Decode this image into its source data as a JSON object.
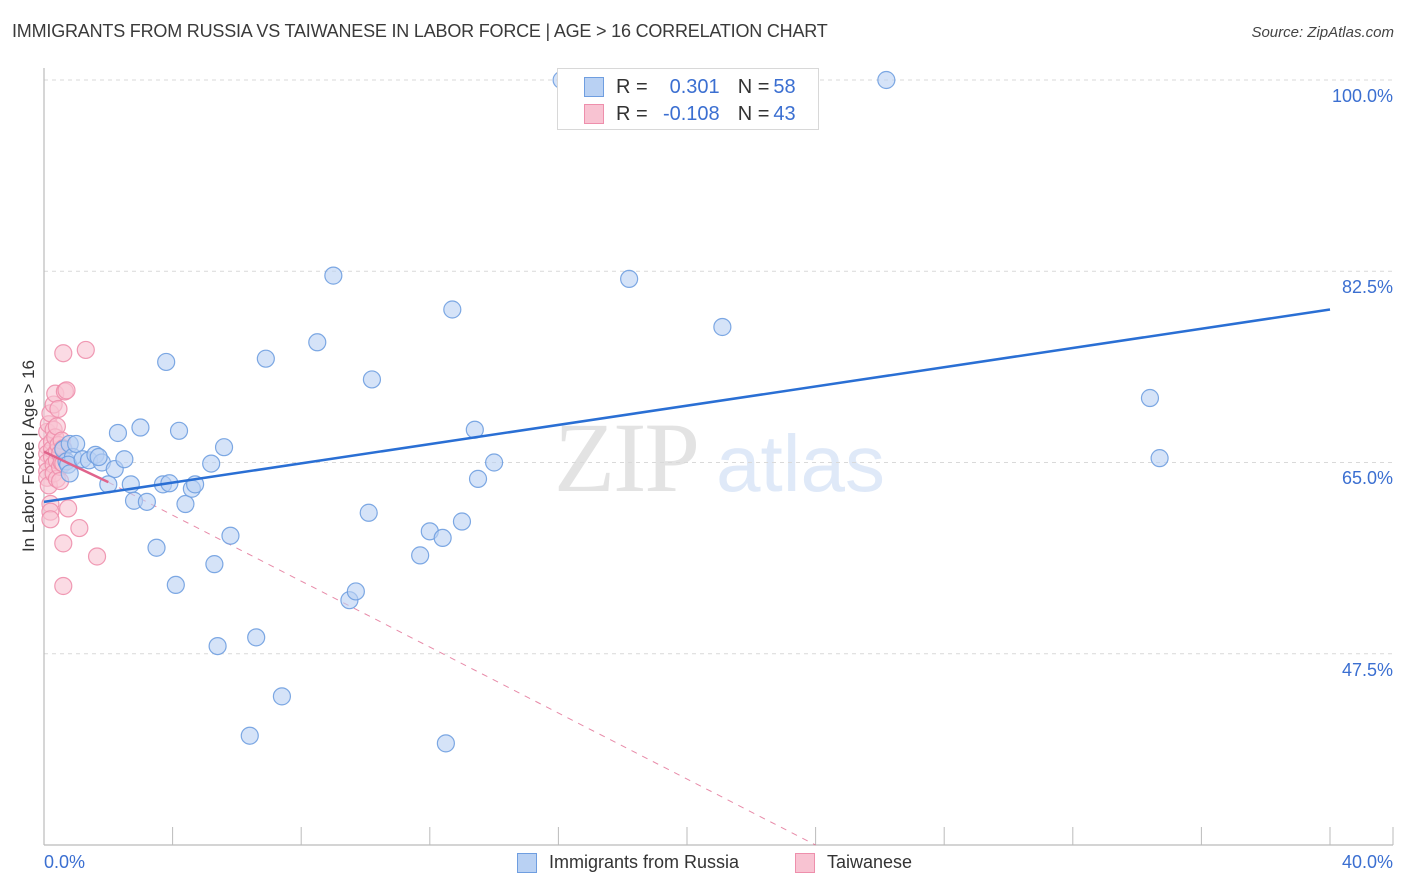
{
  "title": "IMMIGRANTS FROM RUSSIA VS TAIWANESE IN LABOR FORCE | AGE > 16 CORRELATION CHART",
  "source": "Source: ZipAtlas.com",
  "watermark": {
    "zip": "ZIP",
    "atlas": "atlas"
  },
  "legend": {
    "rows": [
      {
        "r_label": "R = ",
        "r_value": "0.301",
        "n_label": "N = ",
        "n_value": "58"
      },
      {
        "r_label": "R = ",
        "r_value": "-0.108",
        "n_label": "N = ",
        "n_value": "43"
      }
    ]
  },
  "colors": {
    "russia_fill": "#b9d1f3",
    "russia_stroke": "#6f9ee0",
    "russia_line": "#2a6fd4",
    "taiwanese_fill": "#f8c3d2",
    "taiwanese_stroke": "#ee8fac",
    "taiwanese_line": "#e0648c",
    "axis_text": "#3b6fd1"
  },
  "chart_data": {
    "type": "scatter",
    "title": "IMMIGRANTS FROM RUSSIA VS TAIWANESE IN LABOR FORCE | AGE > 16 CORRELATION CHART",
    "xlabel": "",
    "ylabel": "In Labor Force | Age > 16",
    "xlim": [
      0,
      40
    ],
    "ylim": [
      30,
      101.5
    ],
    "x_ticks": [
      0,
      4,
      8,
      12,
      16,
      20,
      24,
      28,
      32,
      36,
      40
    ],
    "x_tick_labels": {
      "0": "0.0%",
      "40": "40.0%"
    },
    "y_ticks": [
      47.5,
      65.0,
      82.5,
      100.0
    ],
    "y_tick_labels": [
      "47.5%",
      "65.0%",
      "82.5%",
      "100.0%"
    ],
    "grid": true,
    "legend_position": "bottom",
    "series": [
      {
        "name": "Immigrants from Russia",
        "r": 0.301,
        "n": 58,
        "trend": {
          "x": [
            0,
            40
          ],
          "y": [
            61.4,
            79.0
          ],
          "style": "solid"
        },
        "points": [
          [
            0.6,
            66.2
          ],
          [
            0.7,
            65.1
          ],
          [
            0.8,
            66.7
          ],
          [
            0.9,
            65.5
          ],
          [
            0.75,
            64.8
          ],
          [
            0.8,
            64.0
          ],
          [
            1.0,
            66.7
          ],
          [
            1.2,
            65.3
          ],
          [
            1.4,
            65.2
          ],
          [
            1.6,
            65.7
          ],
          [
            1.8,
            65.0
          ],
          [
            1.7,
            65.5
          ],
          [
            2.2,
            64.4
          ],
          [
            2.0,
            63.0
          ],
          [
            2.3,
            67.7
          ],
          [
            2.5,
            65.3
          ],
          [
            2.7,
            63.0
          ],
          [
            2.8,
            61.5
          ],
          [
            3.0,
            68.2
          ],
          [
            3.2,
            61.4
          ],
          [
            3.5,
            57.2
          ],
          [
            3.7,
            63.0
          ],
          [
            3.8,
            74.2
          ],
          [
            3.9,
            63.1
          ],
          [
            4.1,
            53.8
          ],
          [
            4.2,
            67.9
          ],
          [
            4.4,
            61.2
          ],
          [
            4.6,
            62.6
          ],
          [
            4.7,
            63.0
          ],
          [
            5.2,
            64.9
          ],
          [
            5.3,
            55.7
          ],
          [
            5.4,
            48.2
          ],
          [
            5.6,
            66.4
          ],
          [
            5.8,
            58.3
          ],
          [
            6.4,
            40.0
          ],
          [
            6.6,
            49.0
          ],
          [
            6.9,
            74.5
          ],
          [
            7.4,
            43.6
          ],
          [
            8.5,
            76.0
          ],
          [
            9.0,
            82.1
          ],
          [
            9.5,
            52.4
          ],
          [
            9.7,
            53.2
          ],
          [
            10.1,
            60.4
          ],
          [
            10.2,
            72.6
          ],
          [
            11.7,
            56.5
          ],
          [
            12.0,
            58.7
          ],
          [
            12.4,
            58.1
          ],
          [
            12.5,
            39.3
          ],
          [
            12.7,
            79.0
          ],
          [
            13.0,
            59.6
          ],
          [
            13.4,
            68.0
          ],
          [
            13.5,
            63.5
          ],
          [
            14.0,
            65.0
          ],
          [
            16.1,
            100.0
          ],
          [
            18.2,
            81.8
          ],
          [
            21.1,
            77.4
          ],
          [
            26.2,
            100.0
          ],
          [
            34.4,
            70.9
          ],
          [
            34.7,
            65.4
          ]
        ]
      },
      {
        "name": "Taiwanese",
        "r": -0.108,
        "n": 43,
        "trend": {
          "x": [
            0,
            2.0
          ],
          "y": [
            66.0,
            63.2
          ],
          "style": "solid",
          "extended": {
            "x": [
              2.0,
              24.0
            ],
            "y": [
              63.2,
              30.0
            ],
            "style": "dashed"
          }
        },
        "points": [
          [
            0.1,
            67.8
          ],
          [
            0.1,
            66.5
          ],
          [
            0.1,
            65.8
          ],
          [
            0.1,
            65.0
          ],
          [
            0.1,
            64.2
          ],
          [
            0.1,
            63.6
          ],
          [
            0.15,
            62.9
          ],
          [
            0.15,
            68.5
          ],
          [
            0.2,
            69.5
          ],
          [
            0.2,
            61.2
          ],
          [
            0.2,
            60.5
          ],
          [
            0.2,
            59.8
          ],
          [
            0.25,
            66.9
          ],
          [
            0.25,
            66.2
          ],
          [
            0.25,
            65.5
          ],
          [
            0.3,
            64.8
          ],
          [
            0.3,
            64.0
          ],
          [
            0.3,
            68.0
          ],
          [
            0.3,
            70.3
          ],
          [
            0.35,
            71.3
          ],
          [
            0.35,
            67.3
          ],
          [
            0.4,
            66.0
          ],
          [
            0.4,
            65.2
          ],
          [
            0.4,
            63.5
          ],
          [
            0.4,
            68.3
          ],
          [
            0.45,
            69.9
          ],
          [
            0.45,
            66.6
          ],
          [
            0.5,
            65.8
          ],
          [
            0.5,
            64.6
          ],
          [
            0.5,
            63.3
          ],
          [
            0.55,
            67.0
          ],
          [
            0.55,
            65.0
          ],
          [
            0.6,
            66.3
          ],
          [
            0.6,
            64.9
          ],
          [
            0.6,
            57.6
          ],
          [
            0.65,
            71.5
          ],
          [
            0.6,
            75.0
          ],
          [
            0.6,
            53.7
          ],
          [
            0.7,
            71.6
          ],
          [
            0.75,
            60.8
          ],
          [
            1.1,
            59.0
          ],
          [
            1.3,
            75.3
          ],
          [
            1.65,
            56.4
          ]
        ]
      }
    ]
  }
}
